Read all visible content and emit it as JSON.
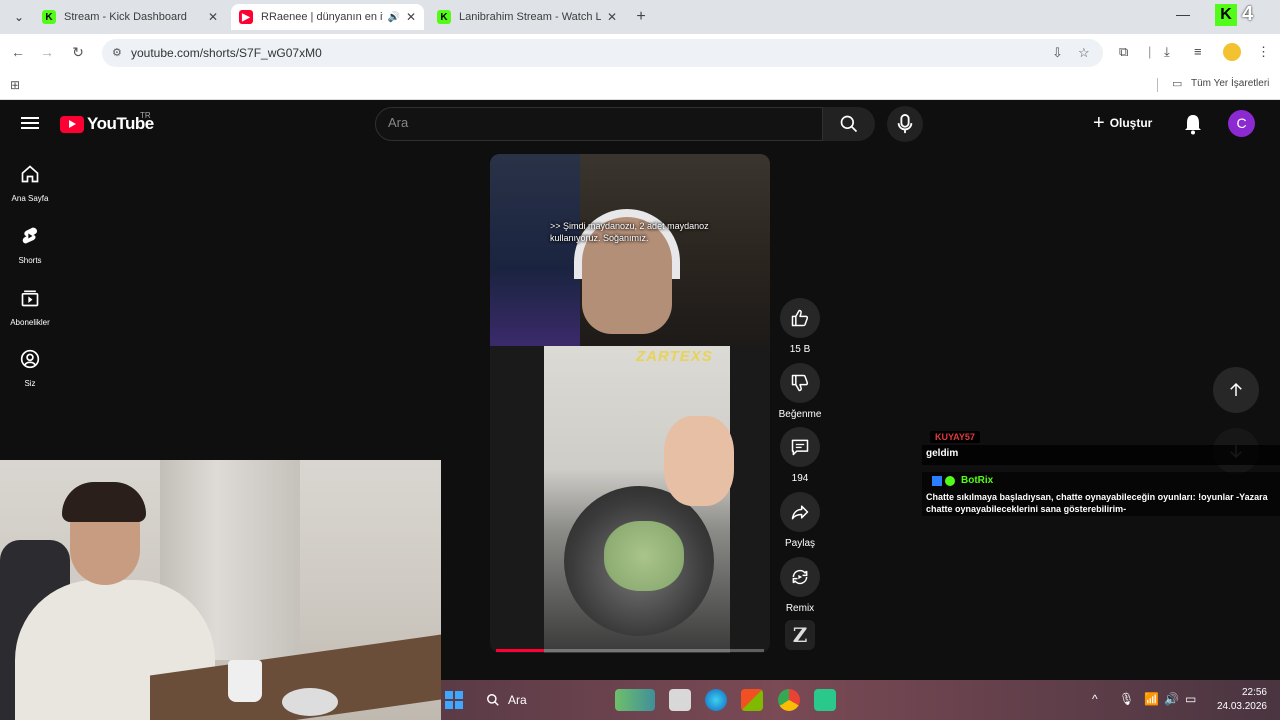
{
  "browser": {
    "tabs": [
      {
        "title": "Stream - Kick Dashboard",
        "favicon": "kick-icon",
        "active": false
      },
      {
        "title": "RRaenee | dünyanın en iyi i...",
        "favicon": "youtube-icon",
        "active": true
      },
      {
        "title": "Lanibrahim Stream - Watch Live",
        "favicon": "kick-icon",
        "active": false
      }
    ],
    "url": "youtube.com/shorts/S7F_wG07xM0",
    "bookmarks_all": "Tüm Yer İşaretleri",
    "kick_counter": "4"
  },
  "youtube": {
    "logo_text": "YouTube",
    "region": "TR",
    "search_placeholder": "Ara",
    "create_label": "Oluştur",
    "avatar_letter": "C",
    "sidebar": [
      {
        "label": "Ana Sayfa",
        "icon": "home-icon"
      },
      {
        "label": "Shorts",
        "icon": "shorts-icon"
      },
      {
        "label": "Abonelikler",
        "icon": "subscriptions-icon"
      },
      {
        "label": "Siz",
        "icon": "account-icon"
      }
    ],
    "short": {
      "caption": ">> Şimdi maydanozu, 2 adet maydanoz kullanıyoruz. Soğanımız.",
      "watermark": "ZARTEXS",
      "progress": 0.18
    },
    "actions": {
      "likes": "15 B",
      "dislike_label": "Beğenme",
      "comments": "194",
      "share_label": "Paylaş",
      "remix_label": "Remix",
      "badge": "Z"
    }
  },
  "chat": {
    "user": "KUYAY57",
    "message": "geldim",
    "bot_name": "BotRix",
    "bot_message_line1": "Chatte sıkılmaya başladıysan, chatte oynayabileceğin oyunları: !oyunlar -Yazara",
    "bot_message_line2": "chatte oynayabileceklerini sana gösterebilirim-"
  },
  "taskbar": {
    "search_label": "Ara",
    "time": "22:56",
    "date": "24.03.2026"
  },
  "colors": {
    "youtube_red": "#ff0033",
    "kick_green": "#53fc18",
    "avatar_purple": "#8b2ad1"
  }
}
